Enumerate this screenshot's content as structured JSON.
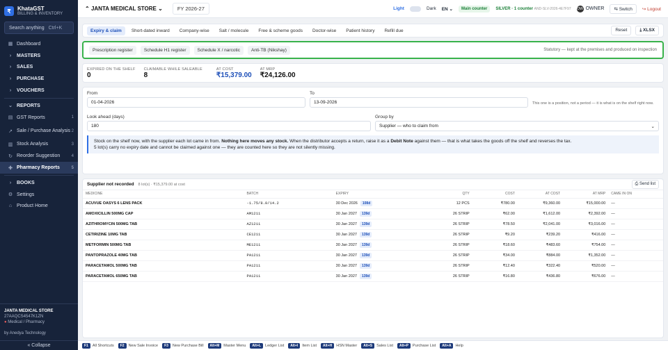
{
  "brand": {
    "logo": "₹",
    "name": "KhataGST",
    "sub": "BILLING & INVENTORY"
  },
  "search": {
    "placeholder": "Search anything",
    "shortcut": "Ctrl+K"
  },
  "nav": [
    {
      "icon": "▦",
      "label": "Dashboard",
      "count": "",
      "kind": "item"
    },
    {
      "icon": "›",
      "label": "MASTERS",
      "count": "",
      "kind": "group"
    },
    {
      "icon": "›",
      "label": "SALES",
      "count": "",
      "kind": "group"
    },
    {
      "icon": "›",
      "label": "PURCHASE",
      "count": "",
      "kind": "group"
    },
    {
      "icon": "›",
      "label": "VOUCHERS",
      "count": "",
      "kind": "group"
    },
    {
      "icon": "⌄",
      "label": "REPORTS",
      "count": "",
      "kind": "group"
    },
    {
      "icon": "▤",
      "label": "GST Reports",
      "count": "1",
      "kind": "item"
    },
    {
      "icon": "↗",
      "label": "Sale / Purchase Analysis",
      "count": "2",
      "kind": "item"
    },
    {
      "icon": "▥",
      "label": "Stock Analysis",
      "count": "3",
      "kind": "item"
    },
    {
      "icon": "↻",
      "label": "Reorder Suggestion",
      "count": "4",
      "kind": "item"
    },
    {
      "icon": "✚",
      "label": "Pharmacy Reports",
      "count": "5",
      "kind": "active"
    },
    {
      "icon": "›",
      "label": "BOOKS",
      "count": "",
      "kind": "group"
    },
    {
      "icon": "⚙",
      "label": "Settings",
      "count": "",
      "kind": "item"
    },
    {
      "icon": "⌂",
      "label": "Product Home",
      "count": "",
      "kind": "item"
    }
  ],
  "footer": {
    "org": "JANTA MEDICAL STORE",
    "gstin": "27AAQCS4547K1ZN",
    "type": "Medical / Pharmacy",
    "by": "by Anedya Technology",
    "collapse": "« Collapse"
  },
  "topbar": {
    "org": "JANTA MEDICAL STORE",
    "fy": "FY 2026-27",
    "light": "Light",
    "dark": "Dark",
    "lang": "EN",
    "counter": "Main counter",
    "plan": "SILVER · 1 counter",
    "plan_code": "AND-SLV-2026-4E7F97",
    "avatar": "OW",
    "owner": "OWNER",
    "switch": "⇆ Switch",
    "logout": "↪ Logout"
  },
  "tabs": [
    "Expiry & claim",
    "Short-dated inward",
    "Company-wise",
    "Salt / molecule",
    "Free & scheme goods",
    "Doctor-wise",
    "Patient history",
    "Refill due"
  ],
  "tab_actions": {
    "reset": "Reset",
    "xlsx": "⤓ XLSX"
  },
  "statutory": {
    "tabs": [
      "Prescription register",
      "Schedule H1 register",
      "Schedule X / narcotic",
      "Anti-TB (Nikshay)"
    ],
    "note": "Statutory — kept at the premises and produced on inspection"
  },
  "stats": [
    {
      "label": "EXPIRED ON THE SHELF",
      "value": "0"
    },
    {
      "label": "CLAIMABLE WHILE SALEABLE",
      "value": "8"
    },
    {
      "label": "AT COST",
      "value": "₹15,379.00"
    },
    {
      "label": "AT MRP",
      "value": "₹24,126.00"
    }
  ],
  "filters": {
    "from_label": "From",
    "from_value": "01-04-2026",
    "to_label": "To",
    "to_value": "13-09-2026",
    "period_note": "This one is a position, not a period — it is what is on the shelf right now.",
    "look_label": "Look ahead (days)",
    "look_value": "180",
    "group_label": "Group by",
    "group_value": "Supplier — who to claim from"
  },
  "info": {
    "p1a": "Stock on the shelf now, with the supplier each lot came in from. ",
    "p1b": "Nothing here moves any stock.",
    "p1c": " When the distributor accepts a return, raise it as a ",
    "p1d": "Debit Note",
    "p1e": " against them — that is what takes the goods off the shelf and reverses the tax.",
    "p2": "5 lot(s) carry no expiry date and cannot be claimed against one — they are counted here so they are not silently missing."
  },
  "table": {
    "title": "Supplier not recorded",
    "sub": "8 lot(s) · ₹15,379.00 at cost",
    "send": "⎙ Send list",
    "headers": [
      "MEDICINE",
      "BATCH",
      "EXPIRY",
      "QTY",
      "COST",
      "AT COST",
      "AT MRP",
      "CAME IN ON"
    ],
    "rows": [
      {
        "medicine": "ACUVUE OASYS 6 LENS PACK",
        "batch": "-1.75/8.0/14.2",
        "expiry": "30 Dec 2026",
        "days": "108d",
        "qty": "12 PCS",
        "cost": "₹780.00",
        "at_cost": "₹9,360.00",
        "at_mrp": "₹15,000.00",
        "came": "—"
      },
      {
        "medicine": "AMOXICILLIN 500MG CAP",
        "batch": "AM1211",
        "expiry": "30 Jan 2027",
        "days": "139d",
        "qty": "26 STRIP",
        "cost": "₹62.00",
        "at_cost": "₹1,612.00",
        "at_mrp": "₹2,392.00",
        "came": "—"
      },
      {
        "medicine": "AZITHROMYCIN 500MG TAB",
        "batch": "AZ1211",
        "expiry": "30 Jan 2027",
        "days": "139d",
        "qty": "26 STRIP",
        "cost": "₹78.50",
        "at_cost": "₹2,041.00",
        "at_mrp": "₹3,016.00",
        "came": "—"
      },
      {
        "medicine": "CETIRIZINE 10MG TAB",
        "batch": "CE1211",
        "expiry": "30 Jan 2027",
        "days": "139d",
        "qty": "26 STRIP",
        "cost": "₹9.20",
        "at_cost": "₹239.20",
        "at_mrp": "₹416.00",
        "came": "—"
      },
      {
        "medicine": "METFORMIN 500MG TAB",
        "batch": "ME1211",
        "expiry": "30 Jan 2027",
        "days": "139d",
        "qty": "26 STRIP",
        "cost": "₹18.60",
        "at_cost": "₹483.60",
        "at_mrp": "₹754.00",
        "came": "—"
      },
      {
        "medicine": "PANTOPRAZOLE 40MG TAB",
        "batch": "PA1211",
        "expiry": "30 Jan 2027",
        "days": "139d",
        "qty": "26 STRIP",
        "cost": "₹34.00",
        "at_cost": "₹884.00",
        "at_mrp": "₹1,352.00",
        "came": "—"
      },
      {
        "medicine": "PARACETAMOL 500MG TAB",
        "batch": "PA1211",
        "expiry": "30 Jan 2027",
        "days": "139d",
        "qty": "26 STRIP",
        "cost": "₹12.40",
        "at_cost": "₹322.40",
        "at_mrp": "₹520.00",
        "came": "—"
      },
      {
        "medicine": "PARACETAMOL 650MG TAB",
        "batch": "PA1211",
        "expiry": "30 Jan 2027",
        "days": "139d",
        "qty": "26 STRIP",
        "cost": "₹16.80",
        "at_cost": "₹436.80",
        "at_mrp": "₹676.00",
        "came": "—"
      }
    ]
  },
  "shortcuts": [
    {
      "key": "F1",
      "label": "All Shortcuts"
    },
    {
      "key": "F2",
      "label": "New Sale Invoice"
    },
    {
      "key": "F3",
      "label": "New Purchase Bill"
    },
    {
      "key": "Alt+M",
      "label": "Master Menu"
    },
    {
      "key": "Alt+L",
      "label": "Ledger List"
    },
    {
      "key": "Alt+I",
      "label": "Item List"
    },
    {
      "key": "Alt+H",
      "label": "HSN Master"
    },
    {
      "key": "Alt+S",
      "label": "Sales List"
    },
    {
      "key": "Alt+P",
      "label": "Purchase List"
    },
    {
      "key": "Alt+A",
      "label": "Help"
    }
  ]
}
